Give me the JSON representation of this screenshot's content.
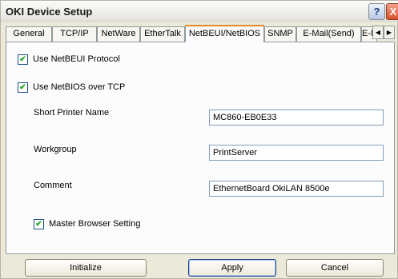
{
  "window": {
    "title": "OKI Device Setup",
    "help_label": "?",
    "close_label": "X"
  },
  "tabs": [
    {
      "label": "General"
    },
    {
      "label": "TCP/IP"
    },
    {
      "label": "NetWare"
    },
    {
      "label": "EtherTalk"
    },
    {
      "label": "NetBEUI/NetBIOS",
      "active": true
    },
    {
      "label": "SNMP"
    },
    {
      "label": "E-Mail(Send)"
    },
    {
      "label": "E-M"
    }
  ],
  "tab_scroll": {
    "left": "◀",
    "right": "▶"
  },
  "panel": {
    "use_netbeui": {
      "label": "Use NetBEUI Protocol",
      "checked": true,
      "mark": "✔"
    },
    "use_netbios": {
      "label": "Use NetBIOS over TCP",
      "checked": true,
      "mark": "✔"
    },
    "short_printer_name": {
      "label": "Short Printer Name",
      "value": "MC860-EB0E33"
    },
    "workgroup": {
      "label": "Workgroup",
      "value": "PrintServer"
    },
    "comment": {
      "label": "Comment",
      "value": "EthernetBoard OkiLAN 8500e"
    },
    "master_browser": {
      "label": "Master Browser Setting",
      "checked": true,
      "mark": "✔"
    }
  },
  "buttons": {
    "initialize": "Initialize",
    "apply": "Apply",
    "cancel": "Cancel"
  }
}
